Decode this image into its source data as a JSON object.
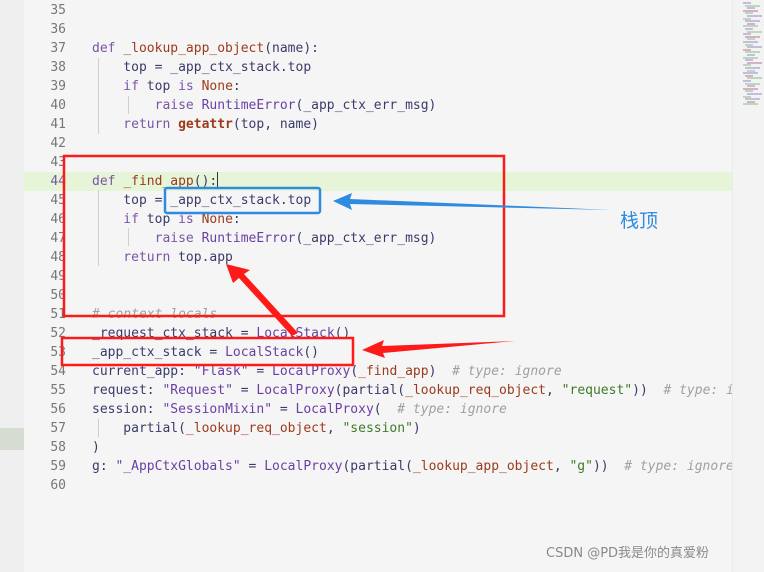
{
  "editor": {
    "lines": [
      {
        "num": "35",
        "tokens": []
      },
      {
        "num": "36",
        "tokens": []
      },
      {
        "num": "37",
        "tokens": [
          [
            "kw",
            "def "
          ],
          [
            "fn",
            "_lookup_app_object"
          ],
          [
            "id",
            "(name):"
          ]
        ]
      },
      {
        "num": "38",
        "tokens": [
          [
            "id",
            "    top = _app_ctx_stack.top"
          ]
        ]
      },
      {
        "num": "39",
        "tokens": [
          [
            "kw",
            "    if "
          ],
          [
            "id",
            "top "
          ],
          [
            "kw",
            "is "
          ],
          [
            "fn",
            "None"
          ],
          [
            "id",
            ":"
          ]
        ]
      },
      {
        "num": "40",
        "tokens": [
          [
            "kw",
            "        raise "
          ],
          [
            "cls",
            "RuntimeError"
          ],
          [
            "id",
            "(_app_ctx_err_msg)"
          ]
        ]
      },
      {
        "num": "41",
        "tokens": [
          [
            "kw",
            "    return "
          ],
          [
            "bi",
            "getattr"
          ],
          [
            "id",
            "(top, name)"
          ]
        ]
      },
      {
        "num": "42",
        "tokens": []
      },
      {
        "num": "43",
        "tokens": []
      },
      {
        "num": "44",
        "tokens": [
          [
            "kw",
            "def "
          ],
          [
            "fn",
            "_find_app"
          ],
          [
            "id",
            "():"
          ]
        ]
      },
      {
        "num": "45",
        "tokens": [
          [
            "id",
            "    top = _app_ctx_stack.top"
          ]
        ]
      },
      {
        "num": "46",
        "tokens": [
          [
            "kw",
            "    if "
          ],
          [
            "id",
            "top "
          ],
          [
            "kw",
            "is "
          ],
          [
            "fn",
            "None"
          ],
          [
            "id",
            ":"
          ]
        ]
      },
      {
        "num": "47",
        "tokens": [
          [
            "kw",
            "        raise "
          ],
          [
            "cls",
            "RuntimeError"
          ],
          [
            "id",
            "(_app_ctx_err_msg)"
          ]
        ]
      },
      {
        "num": "48",
        "tokens": [
          [
            "kw",
            "    return "
          ],
          [
            "id",
            "top.app"
          ]
        ]
      },
      {
        "num": "49",
        "tokens": []
      },
      {
        "num": "50",
        "tokens": []
      },
      {
        "num": "51",
        "tokens": [
          [
            "cm",
            "# context locals"
          ]
        ]
      },
      {
        "num": "52",
        "tokens": [
          [
            "id",
            "_request_ctx_stack = "
          ],
          [
            "cls",
            "LocalStack"
          ],
          [
            "id",
            "()"
          ]
        ]
      },
      {
        "num": "53",
        "tokens": [
          [
            "id",
            "_app_ctx_stack = "
          ],
          [
            "cls",
            "LocalStack"
          ],
          [
            "id",
            "()"
          ]
        ]
      },
      {
        "num": "54",
        "tokens": [
          [
            "id",
            "current_app: "
          ],
          [
            "strq",
            "\"Flask\""
          ],
          [
            "id",
            " = "
          ],
          [
            "cls",
            "LocalProxy"
          ],
          [
            "id",
            "("
          ],
          [
            "fn",
            "_find_app"
          ],
          [
            "id",
            ")  "
          ],
          [
            "cm",
            "# type: ignore"
          ]
        ]
      },
      {
        "num": "55",
        "tokens": [
          [
            "id",
            "request: "
          ],
          [
            "strq",
            "\"Request\""
          ],
          [
            "id",
            " = "
          ],
          [
            "cls",
            "LocalProxy"
          ],
          [
            "id",
            "(partial("
          ],
          [
            "fn",
            "_lookup_req_object"
          ],
          [
            "id",
            ", "
          ],
          [
            "str",
            "\"request\""
          ],
          [
            "id",
            "))  "
          ],
          [
            "cm",
            "# type: ignore"
          ]
        ]
      },
      {
        "num": "56",
        "tokens": [
          [
            "id",
            "session: "
          ],
          [
            "strq",
            "\"SessionMixin\""
          ],
          [
            "id",
            " = "
          ],
          [
            "cls",
            "LocalProxy"
          ],
          [
            "id",
            "(  "
          ],
          [
            "cm",
            "# type: ignore"
          ]
        ]
      },
      {
        "num": "57",
        "tokens": [
          [
            "id",
            "    partial("
          ],
          [
            "fn",
            "_lookup_req_object"
          ],
          [
            "id",
            ", "
          ],
          [
            "str",
            "\"session\""
          ],
          [
            "id",
            ")"
          ]
        ]
      },
      {
        "num": "58",
        "tokens": [
          [
            "id",
            ")"
          ]
        ]
      },
      {
        "num": "59",
        "tokens": [
          [
            "id",
            "g: "
          ],
          [
            "strq",
            "\"_AppCtxGlobals\""
          ],
          [
            "id",
            " = "
          ],
          [
            "cls",
            "LocalProxy"
          ],
          [
            "id",
            "(partial("
          ],
          [
            "fn",
            "_lookup_app_object"
          ],
          [
            "id",
            ", "
          ],
          [
            "str",
            "\"g\""
          ],
          [
            "id",
            "))  "
          ],
          [
            "cm",
            "# type: ignore"
          ]
        ]
      },
      {
        "num": "60",
        "tokens": []
      }
    ],
    "active_line": "44"
  },
  "annotations": {
    "stack_top_label": "栈顶"
  },
  "watermark": "CSDN @PD我是你的真爱粉",
  "colors": {
    "red_annotation": "#ff1a1a",
    "blue_annotation": "#2e8be0",
    "active_line_bg": "#e6f5d8"
  }
}
